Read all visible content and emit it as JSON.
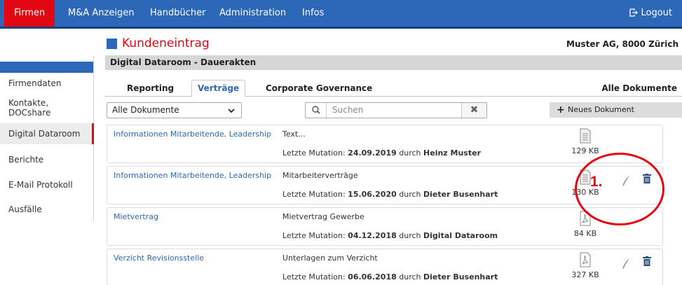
{
  "nav": {
    "items": [
      "Firmen",
      "M&A Anzeigen",
      "Handbücher",
      "Administration",
      "Infos"
    ],
    "logout": "Logout"
  },
  "sidebar": {
    "items": [
      "Firmendaten",
      "Kontakte, DOCshare",
      "Digital Dataroom",
      "Berichte",
      "E-Mail Protokoll",
      "Ausfälle"
    ],
    "active": "Digital Dataroom"
  },
  "header": {
    "title": "Kundeneintrag",
    "company": "Muster AG, 8000 Zürich",
    "section": "Digital Dataroom - Dauerakten"
  },
  "tabs": {
    "items": [
      "Reporting",
      "Verträge",
      "Corporate Governance"
    ],
    "active": "Verträge",
    "all_docs": "Alle Dokumente"
  },
  "filter": {
    "select_value": "Alle Dokumente",
    "search_placeholder": "Suchen",
    "new_doc": "Neues Dokument"
  },
  "documents": [
    {
      "category": "Informationen Mitarbeitende, Leadership",
      "description": "Text...",
      "mut_label": "Letzte Mutation:",
      "date": "24.09.2019",
      "by": "durch",
      "author": "Heinz Muster",
      "size": "129 KB",
      "type": "doc",
      "actions": false
    },
    {
      "category": "Informationen Mitarbeitende, Leadership",
      "description": "Mitarbeiterverträge",
      "mut_label": "Letzte Mutation:",
      "date": "15.06.2020",
      "by": "durch",
      "author": "Dieter Busenhart",
      "size": "130 KB",
      "type": "doc",
      "actions": true
    },
    {
      "category": "Mietvertrag",
      "description": "Mietvertrag Gewerbe",
      "mut_label": "Letzte Mutation:",
      "date": "04.12.2018",
      "by": "durch",
      "author": "Digital Dataroom",
      "size": "84 KB",
      "type": "pdf",
      "actions": false
    },
    {
      "category": "Verzicht Revisionsstelle",
      "description": "Unterlagen zum Verzicht",
      "mut_label": "Letzte Mutation:",
      "date": "06.06.2018",
      "by": "durch",
      "author": "Dieter Busenhart",
      "size": "327 KB",
      "type": "pdf",
      "actions": true
    }
  ],
  "annotation": "1.",
  "colors": {
    "brand_blue": "#2d68b8",
    "brand_red": "#e30613"
  }
}
